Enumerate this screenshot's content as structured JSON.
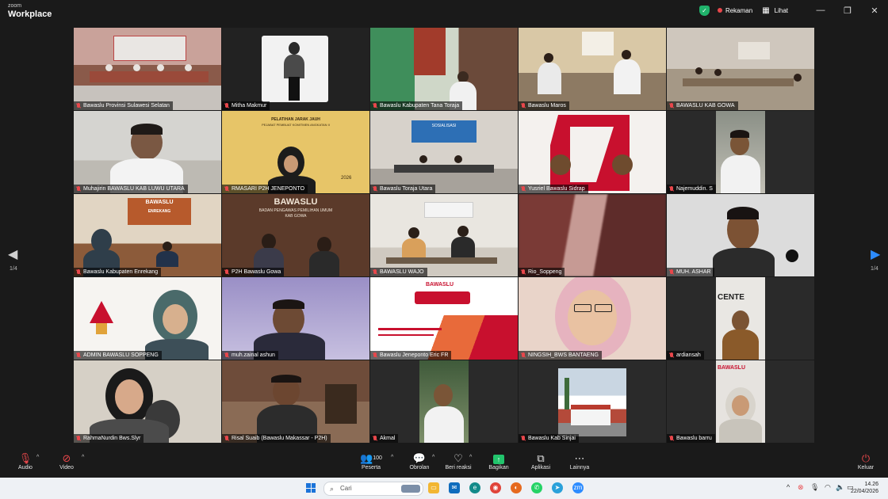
{
  "app": {
    "brand_small": "zoom",
    "brand_big": "Workplace"
  },
  "titlebar": {
    "recording": "Rekaman",
    "view": "Lihat",
    "shield_icon": "shield-check-icon"
  },
  "pager": {
    "left": "1/4",
    "right": "1/4"
  },
  "participants": [
    {
      "name": "Bawaslu Provinsi Sulawesi Selatan",
      "active": true
    },
    {
      "name": "Mitha Makmur"
    },
    {
      "name": "Bawaslu Kabupaten Tana Toraja"
    },
    {
      "name": "Bawaslu Maros"
    },
    {
      "name": "BAWASLU KAB GOWA"
    },
    {
      "name": "Muhajirin BAWASLU KAB LUWU UTARA"
    },
    {
      "name": "RMASARI P2H JENEPONTO"
    },
    {
      "name": "Bawaslu Toraja Utara"
    },
    {
      "name": "Yusriel Bawaslu Sidrap"
    },
    {
      "name": "Najemuddin. S"
    },
    {
      "name": "Bawaslu Kabupaten Enrekang"
    },
    {
      "name": "P2H Bawaslu Gowa"
    },
    {
      "name": "BAWASLU WAJO"
    },
    {
      "name": "Rio_Soppeng"
    },
    {
      "name": "MUH. ASHAR"
    },
    {
      "name": "ADMIN BAWASLU SOPPENG"
    },
    {
      "name": "muh.zainal ashun"
    },
    {
      "name": "Bawaslu Jeneponto Eric FR"
    },
    {
      "name": "NINGSIH_BWS BANTAENG"
    },
    {
      "name": "ardiansah"
    },
    {
      "name": "RahmaNurdin Bws.Slyr"
    },
    {
      "name": "Risal Suaib (Bawaslu Makassar - P2H)"
    },
    {
      "name": "Akmal"
    },
    {
      "name": "Bawaslu Kab Sinjai"
    },
    {
      "name": "Bawaslu barru"
    }
  ],
  "tile_text": {
    "t7_line1": "PELATIHAN JARAK JAUH",
    "t7_line2": "PEJABAT PEMBUAT KOMITMEN ANGKATAN II",
    "t7_year": "2026",
    "t8_banner": "SOSIALISASI",
    "t11_sign": "BAWASLU",
    "t11_sign2": "ENREKANG",
    "t12_line1": "BAWASLU",
    "t12_line2": "BADAN PENGAWAS PEMILIHAN UMUM",
    "t12_line3": "KAB GOWA",
    "t18_brand": "BAWASLU",
    "t20_wall": "CENTE",
    "t25_sign": "BAWASLU"
  },
  "toolbar": {
    "audio": "Audio",
    "video": "Video",
    "participants_count": "100",
    "participants": "Peserta",
    "chat": "Obrolan",
    "react": "Beri reaksi",
    "share": "Bagikan",
    "apps": "Aplikasi",
    "more": "Lainnya",
    "leave": "Keluar"
  },
  "taskbar": {
    "search": "Cari",
    "time": "14.26",
    "date": "22/04/2026"
  },
  "colors": {
    "active_border": "#2fd27c",
    "muted": "#e8474b",
    "share": "#22c46c"
  }
}
